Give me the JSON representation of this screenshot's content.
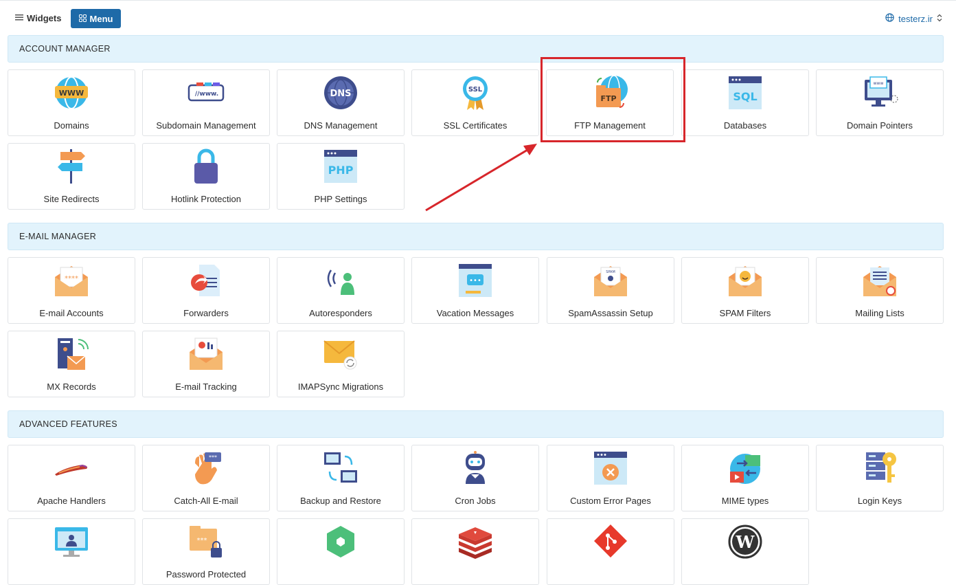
{
  "topbar": {
    "widgets_label": "Widgets",
    "menu_label": "Menu",
    "domain": "testerz.ir"
  },
  "sections": {
    "account": {
      "title": "ACCOUNT MANAGER",
      "tiles": [
        "Domains",
        "Subdomain Management",
        "DNS Management",
        "SSL Certificates",
        "FTP Management",
        "Databases",
        "Domain Pointers",
        "Site Redirects",
        "Hotlink Protection",
        "PHP Settings"
      ]
    },
    "email": {
      "title": "E-MAIL MANAGER",
      "tiles": [
        "E-mail Accounts",
        "Forwarders",
        "Autoresponders",
        "Vacation Messages",
        "SpamAssassin Setup",
        "SPAM Filters",
        "Mailing Lists",
        "MX Records",
        "E-mail Tracking",
        "IMAPSync Migrations"
      ]
    },
    "advanced": {
      "title": "ADVANCED FEATURES",
      "tiles": [
        "Apache Handlers",
        "Catch-All E-mail",
        "Backup and Restore",
        "Cron Jobs",
        "Custom Error Pages",
        "MIME types",
        "Login Keys",
        "",
        "Password Protected",
        "",
        "",
        "",
        ""
      ]
    }
  },
  "icon_text": {
    "www": "WWW",
    "dns": "DNS",
    "ssl": "SSL",
    "ftp": "FTP",
    "sql": "SQL",
    "php": "PHP"
  },
  "colors": {
    "accent": "#1e6aa8",
    "section_bg": "#e2f3fc",
    "highlight": "#d7262b"
  }
}
